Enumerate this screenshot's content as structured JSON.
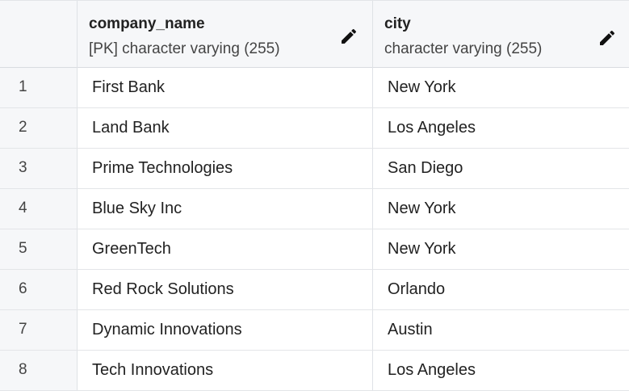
{
  "table": {
    "columns": [
      {
        "name": "company_name",
        "type": "[PK] character varying (255)",
        "icon": "pencil-icon"
      },
      {
        "name": "city",
        "type": "character varying (255)",
        "icon": "pencil-icon"
      }
    ],
    "rows": [
      {
        "num": "1",
        "company_name": "First Bank",
        "city": "New York"
      },
      {
        "num": "2",
        "company_name": "Land Bank",
        "city": "Los Angeles"
      },
      {
        "num": "3",
        "company_name": "Prime Technologies",
        "city": "San Diego"
      },
      {
        "num": "4",
        "company_name": "Blue Sky Inc",
        "city": "New York"
      },
      {
        "num": "5",
        "company_name": "GreenTech",
        "city": "New York"
      },
      {
        "num": "6",
        "company_name": "Red Rock Solutions",
        "city": "Orlando"
      },
      {
        "num": "7",
        "company_name": "Dynamic Innovations",
        "city": "Austin"
      },
      {
        "num": "8",
        "company_name": "Tech Innovations",
        "city": "Los Angeles"
      }
    ]
  }
}
